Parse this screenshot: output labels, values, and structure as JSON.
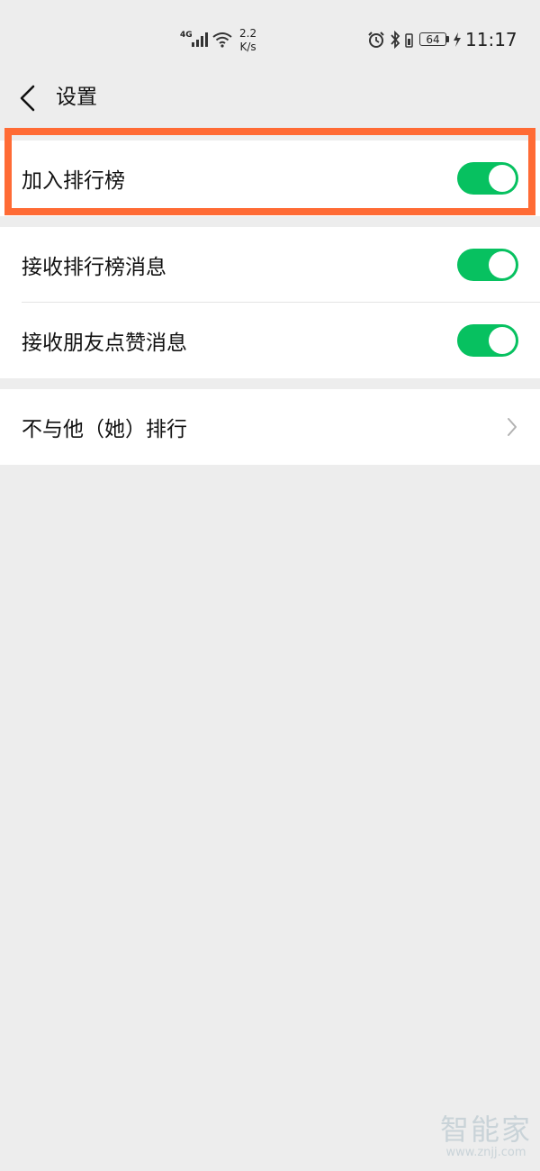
{
  "status_bar": {
    "network": "4G",
    "speed_value": "2.2",
    "speed_unit": "K/s",
    "battery": "64",
    "time": "11:17",
    "icons": [
      "signal-icon",
      "wifi-icon",
      "alarm-icon",
      "bluetooth-icon",
      "vibrate-icon",
      "battery-icon",
      "charging-icon"
    ]
  },
  "header": {
    "title": "设置",
    "back_icon": "back-chevron-icon"
  },
  "settings": {
    "join_ranking": {
      "label": "加入排行榜",
      "enabled": true
    },
    "receive_ranking_messages": {
      "label": "接收排行榜消息",
      "enabled": true
    },
    "receive_like_messages": {
      "label": "接收朋友点赞消息",
      "enabled": true
    },
    "exclude_from_ranking": {
      "label": "不与他（她）排行"
    }
  },
  "colors": {
    "toggle_on": "#07c160",
    "highlight": "#ff6b35",
    "background": "#ededed"
  },
  "watermark": {
    "main": "智能家",
    "sub": "www.znjj.com"
  }
}
